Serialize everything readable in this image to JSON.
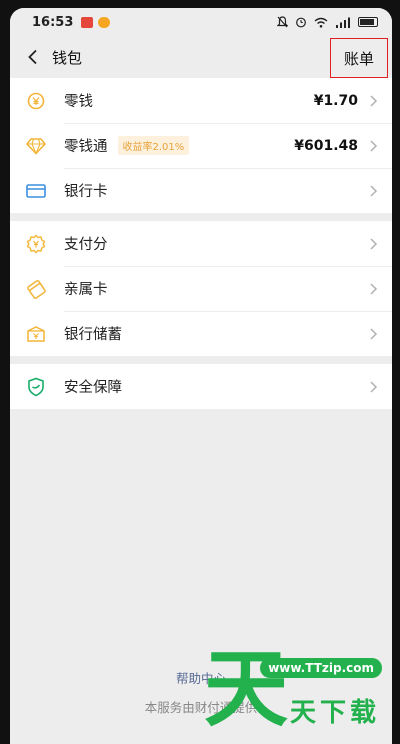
{
  "status_bar": {
    "time": "16:53"
  },
  "nav": {
    "title": "钱包",
    "bill_label": "账单"
  },
  "sections": [
    [
      {
        "label": "零钱",
        "value": "¥1.70",
        "icon": "yuan-coin-icon"
      },
      {
        "label": "零钱通",
        "badge": "收益率2.01%",
        "value": "¥601.48",
        "icon": "diamond-icon"
      },
      {
        "label": "银行卡",
        "icon": "bank-card-icon"
      }
    ],
    [
      {
        "label": "支付分",
        "icon": "pay-score-icon"
      },
      {
        "label": "亲属卡",
        "icon": "family-card-icon"
      },
      {
        "label": "银行储蓄",
        "icon": "savings-box-icon"
      }
    ],
    [
      {
        "label": "安全保障",
        "icon": "shield-icon"
      }
    ]
  ],
  "footer": {
    "help_link": "帮助中心",
    "service_text": "本服务由财付通提供"
  },
  "watermark": {
    "big_char": "天",
    "url": "www.TTzip.com",
    "text": "天下载"
  },
  "colors": {
    "accent_yellow": "#f2b53a",
    "accent_green": "#1aad6a",
    "card_blue": "#3b8ee0",
    "highlight_red": "#e02020"
  }
}
